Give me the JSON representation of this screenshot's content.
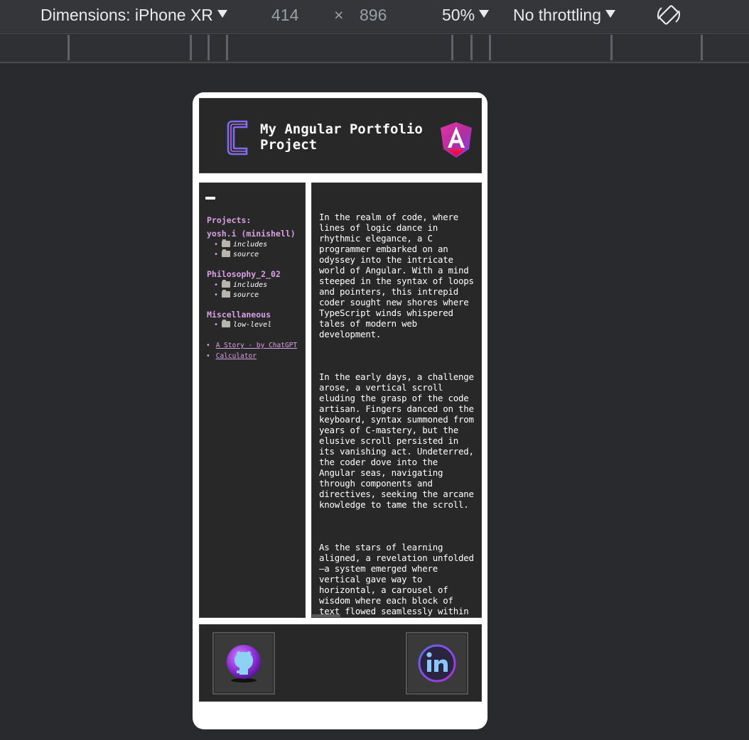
{
  "devtools": {
    "dimensions_label": "Dimensions: iPhone XR",
    "width": "414",
    "times": "×",
    "height": "896",
    "zoom": "50%",
    "throttling": "No throttling",
    "rotate_icon": "rotate-icon"
  },
  "header": {
    "title": "My Angular Portfolio Project",
    "logo_left_icon": "c-logo-icon",
    "logo_right_icon": "angular-logo-icon"
  },
  "sidebar": {
    "toggle_icon": "menu-toggle-icon",
    "heading": "Projects:",
    "groups": [
      {
        "name": "yosh.i (minishell)",
        "items": [
          "includes",
          "source"
        ]
      },
      {
        "name": "Philosophy_2_02",
        "items": [
          "includes",
          "source"
        ]
      },
      {
        "name": "Miscellaneous",
        "items": [
          "low-level"
        ]
      }
    ],
    "links": [
      "A Story - by ChatGPT",
      "Calculator"
    ]
  },
  "main": {
    "paragraphs": [
      "In the realm of code, where lines of logic dance in rhythmic elegance, a C programmer embarked on an odyssey into the intricate world of Angular. With a mind steeped in the syntax of loops and pointers, this intrepid coder sought new shores where TypeScript winds whispered tales of modern web development.",
      "In the early days, a challenge arose, a vertical scroll eluding the grasp of the code artisan. Fingers danced on the keyboard, syntax summoned from years of C-mastery, but the elusive scroll persisted in its vanishing act. Undeterred, the coder dove into the Angular seas, navigating through components and directives, seeking the arcane knowledge to tame the scroll.",
      "As the stars of learning aligned, a revelation unfolded—a system emerged where vertical gave way to horizontal, a carousel of wisdom where each block of text flowed seamlessly within the column's embrace. Poetry of code"
    ]
  },
  "footer": {
    "github_icon": "github-icon",
    "linkedin_icon": "linkedin-icon"
  },
  "colors": {
    "accent": "#d9a0e6",
    "panel": "#282828",
    "page_bg": "#292a2d"
  }
}
